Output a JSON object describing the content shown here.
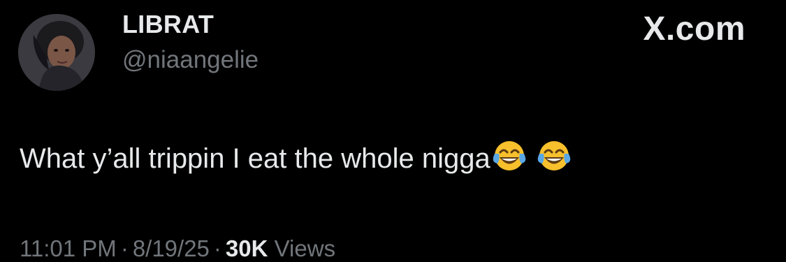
{
  "author": {
    "display_name": "LIBRAT",
    "handle": "@niaangelie",
    "avatar_icon": "profile-photo"
  },
  "brand": {
    "label": "X.com"
  },
  "tweet": {
    "text": "What y’all trippin I eat the whole nigga",
    "emojis": [
      "face-with-tears-of-joy-icon",
      "face-with-tears-of-joy-icon"
    ]
  },
  "meta": {
    "time": "11:01 PM",
    "separator": "·",
    "date": "8/19/25",
    "views_count": "30K",
    "views_label": "Views"
  },
  "colors": {
    "background": "#000000",
    "primary_text": "#e7e9ea",
    "secondary_text": "#71767b"
  }
}
